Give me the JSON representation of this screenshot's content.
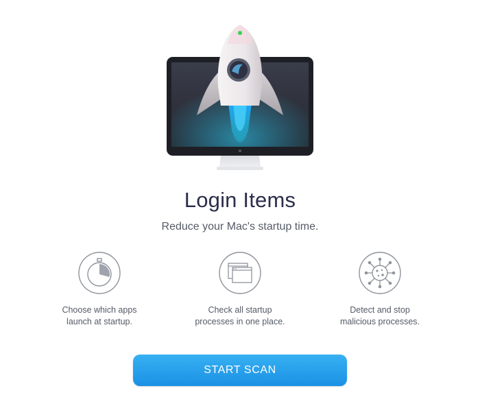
{
  "title": "Login Items",
  "subtitle": "Reduce your Mac's startup time.",
  "features": [
    {
      "icon": "stopwatch-icon",
      "text": "Choose which apps\nlaunch at startup."
    },
    {
      "icon": "windows-icon",
      "text": "Check all startup\nprocesses in one place."
    },
    {
      "icon": "virus-icon",
      "text": "Detect and stop\nmalicious processes."
    }
  ],
  "button": {
    "label": "START SCAN"
  },
  "colors": {
    "accent": "#1b90e4",
    "title": "#2a2e4a",
    "text": "#555a66",
    "icon_stroke": "#8f939c"
  }
}
